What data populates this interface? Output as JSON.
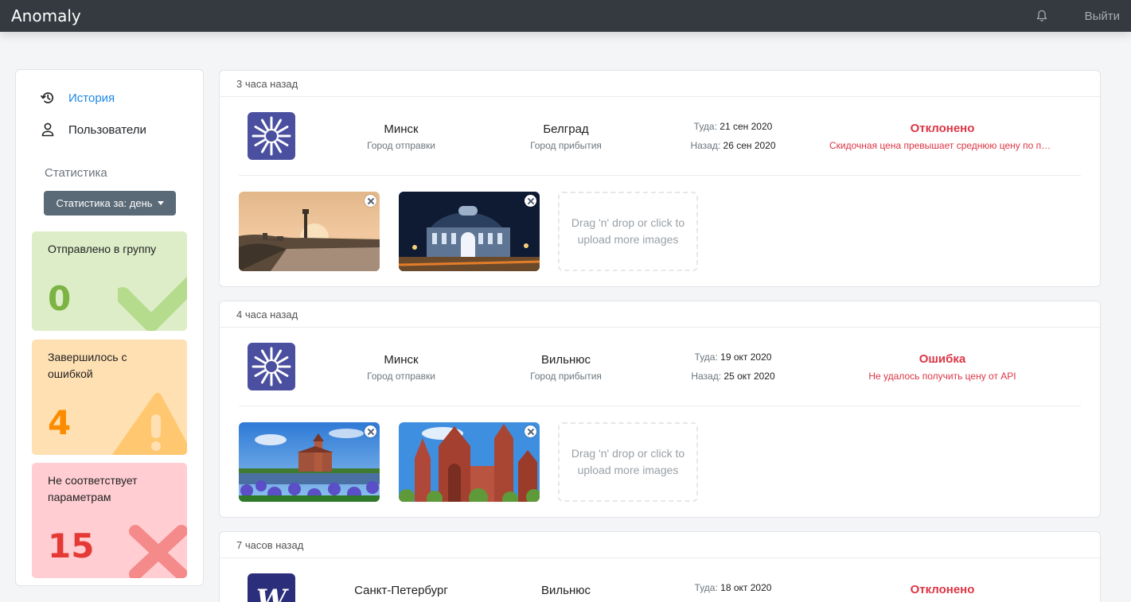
{
  "app": {
    "brand": "Anomaly",
    "logout_label": "Выйти"
  },
  "sidebar": {
    "nav": [
      {
        "label": "История",
        "icon": "history-icon",
        "active": true
      },
      {
        "label": "Пользователи",
        "icon": "user-icon",
        "active": false
      }
    ],
    "stats_title": "Статистика",
    "stats_button": "Статистика за: день",
    "stats": [
      {
        "label": "Отправлено в группу",
        "value": "0",
        "color": "#7cb342",
        "icon": "check-icon"
      },
      {
        "label": "Завершилось с ошибкой",
        "value": "4",
        "color": "#fb8c00",
        "icon": "warning-icon"
      },
      {
        "label": "Не соответствует параметрам",
        "value": "15",
        "color": "#e53935",
        "icon": "cross-icon"
      }
    ]
  },
  "common": {
    "departure_caption": "Город отправки",
    "arrival_caption": "Город прибытия",
    "there_key": "Туда:",
    "back_key": "Назад:",
    "dropzone_text": "Drag 'n' drop or click to upload more images"
  },
  "cards": [
    {
      "time": "3 часа назад",
      "logo": "cornflower-logo",
      "from": "Минск",
      "to": "Белград",
      "there_date": "21 сен 2020",
      "back_date": "26 сен 2020",
      "status_title": "Отклонено",
      "status_desc": "Скидочная цена превышает среднюю цену по периоду",
      "status_color": "#dc3545",
      "images": [
        "belgrade-fortress-sunset-photo",
        "belgrade-building-night-photo"
      ]
    },
    {
      "time": "4 часа назад",
      "logo": "cornflower-logo",
      "from": "Минск",
      "to": "Вильнюс",
      "there_date": "19 окт 2020",
      "back_date": "25 окт 2020",
      "status_title": "Ошибка",
      "status_desc": "Не удалось получить цену от API",
      "status_color": "#dc3545",
      "images": [
        "trakai-castle-photo",
        "vilnius-church-photo"
      ]
    },
    {
      "time": "7 часов назад",
      "logo": "wizz-logo",
      "from": "Санкт-Петербург",
      "to": "Вильнюс",
      "there_date": "18 окт 2020",
      "status_title": "Отклонено",
      "status_color": "#dc3545"
    }
  ]
}
